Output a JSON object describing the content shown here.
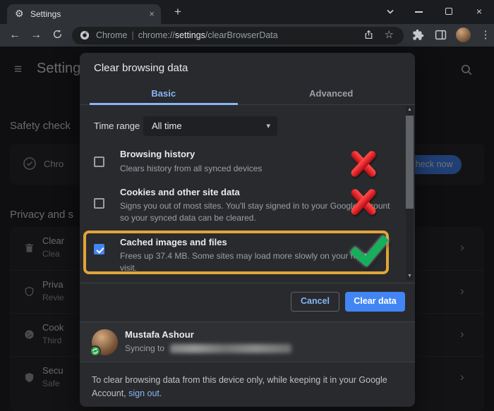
{
  "window": {
    "tab_title": "Settings"
  },
  "toolbar": {
    "url": {
      "app": "Chrome",
      "sep": "|",
      "scheme": "chrome://",
      "host": "settings",
      "path": "/clearBrowserData"
    }
  },
  "icons": {
    "gear": "⚙",
    "close": "×",
    "plus": "+",
    "back": "←",
    "forward": "→",
    "star": "☆",
    "menu_dots": "⋮",
    "hamburger": "≡",
    "chevron_right": "›",
    "caret_down": "▾",
    "scroll_up": "▲",
    "scroll_down": "▼",
    "x_mark": "css-x-shape",
    "check_mark": "css-check-shape"
  },
  "settings_page": {
    "title": "Settings",
    "safety_check_heading": "Safety check",
    "safety_card_text": "Chro",
    "check_now_label": "check now",
    "privacy_heading": "Privacy and s",
    "rows": [
      {
        "title": "Clear",
        "desc": "Clea"
      },
      {
        "title": "Priva",
        "desc": "Revie"
      },
      {
        "title": "Cook",
        "desc": "Third"
      },
      {
        "title": "Secu",
        "desc": "Safe"
      }
    ]
  },
  "dialog": {
    "title": "Clear browsing data",
    "tabs": [
      {
        "label": "Basic"
      },
      {
        "label": "Advanced"
      }
    ],
    "time_range_label": "Time range",
    "time_range_value": "All time",
    "rows": [
      {
        "title": "Browsing history",
        "desc": "Clears history from all synced devices",
        "checked": false
      },
      {
        "title": "Cookies and other site data",
        "desc": "Signs you out of most sites. You'll stay signed in to your Google Account so your synced data can be cleared.",
        "checked": false
      },
      {
        "title": "Cached images and files",
        "desc": "Frees up 37.4 MB. Some sites may load more slowly on your next visit.",
        "checked": true
      }
    ],
    "cancel_label": "Cancel",
    "confirm_label": "Clear data",
    "account": {
      "name": "Mustafa Ashour",
      "status": "Syncing to"
    },
    "footer": {
      "text": "To clear browsing data from this device only, while keeping it in your Google Account, ",
      "link": "sign out."
    }
  },
  "colors": {
    "accent": "#8ab4f8",
    "button_blue": "#4285f4",
    "annotation_red": "#e4252b",
    "annotation_green": "#14b05c",
    "highlight_gold": "#e2a438",
    "badge_green": "#31a24c",
    "text": "#e8eaed",
    "text_dim": "#9aa0a6"
  }
}
